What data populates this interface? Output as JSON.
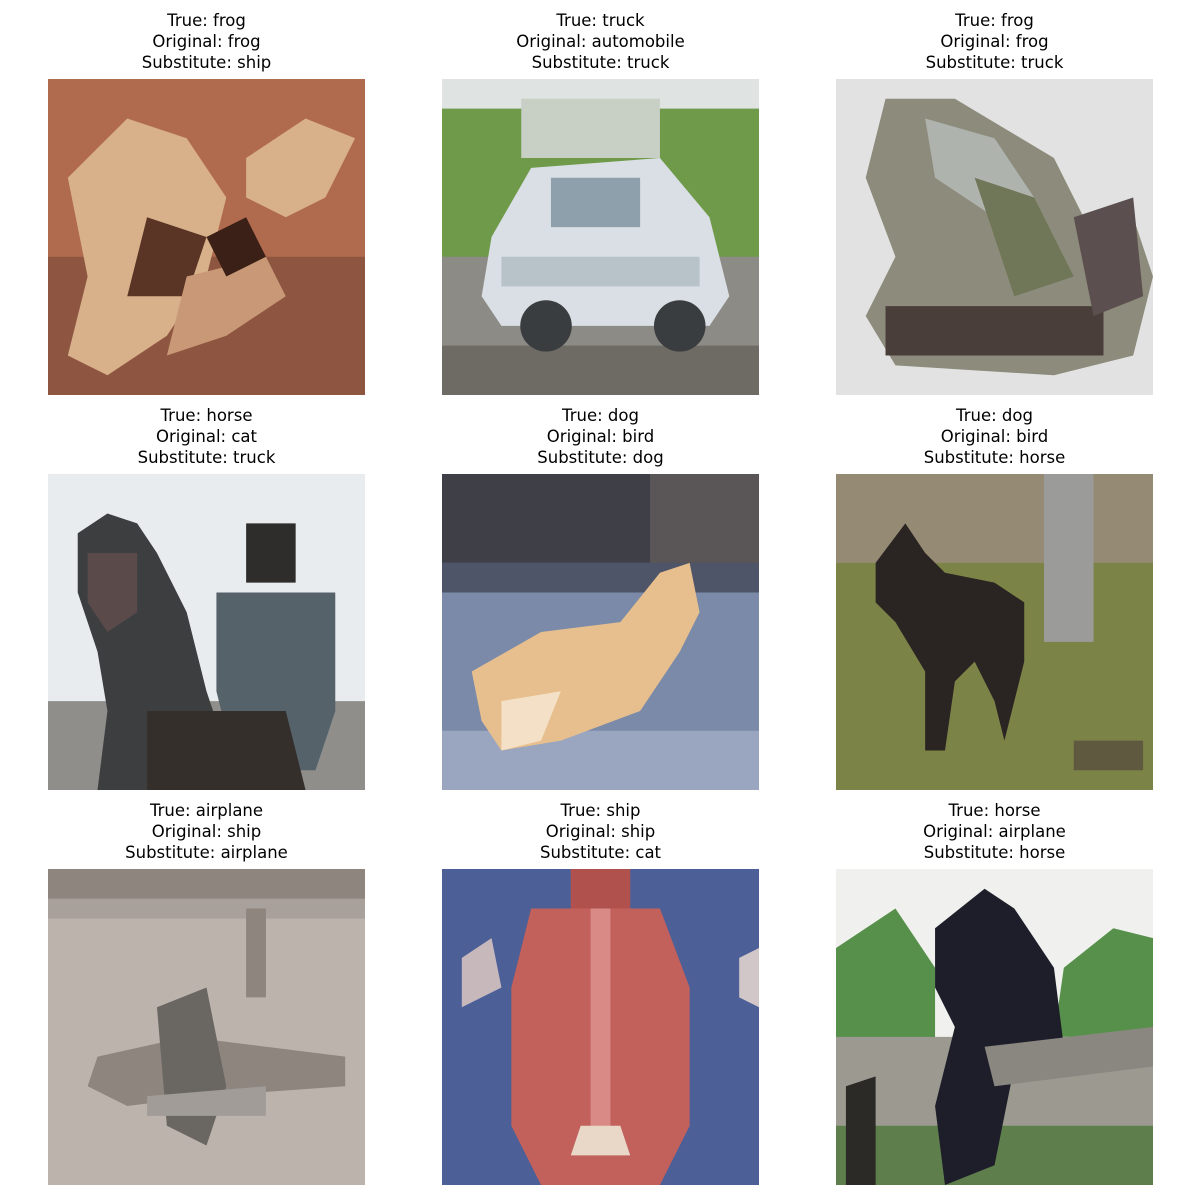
{
  "panels": [
    {
      "true_label": "True: frog",
      "original_label": "Original: frog",
      "substitute_label": "Substitute: ship",
      "image_subject": "frog",
      "palette": [
        "#b06a4e",
        "#d8b08a",
        "#5a3424"
      ]
    },
    {
      "true_label": "True: truck",
      "original_label": "Original: automobile",
      "substitute_label": "Substitute: truck",
      "image_subject": "truck",
      "palette": [
        "#6f9a4a",
        "#d9dfe4",
        "#3a3d40"
      ]
    },
    {
      "true_label": "True: frog",
      "original_label": "Original: frog",
      "substitute_label": "Substitute: truck",
      "image_subject": "frog",
      "palette": [
        "#e2e2e2",
        "#8d8b7c",
        "#4a3e3a"
      ]
    },
    {
      "true_label": "True: horse",
      "original_label": "Original: cat",
      "substitute_label": "Substitute: truck",
      "image_subject": "horse with rider",
      "palette": [
        "#e9ecef",
        "#56626a",
        "#2f2c2c"
      ]
    },
    {
      "true_label": "True: dog",
      "original_label": "Original: bird",
      "substitute_label": "Substitute: dog",
      "image_subject": "dog lying on floor",
      "palette": [
        "#7a8aa8",
        "#e7bf8e",
        "#3f3f47"
      ]
    },
    {
      "true_label": "True: dog",
      "original_label": "Original: bird",
      "substitute_label": "Substitute: horse",
      "image_subject": "dog on grass",
      "palette": [
        "#7c8347",
        "#2a2422",
        "#9b9b9a"
      ]
    },
    {
      "true_label": "True: airplane",
      "original_label": "Original: ship",
      "substitute_label": "Substitute: airplane",
      "image_subject": "airplane",
      "palette": [
        "#bdb3ad",
        "#8e857f",
        "#6a6762"
      ]
    },
    {
      "true_label": "True: ship",
      "original_label": "Original: ship",
      "substitute_label": "Substitute: cat",
      "image_subject": "ship",
      "palette": [
        "#4c5f97",
        "#c2605c",
        "#e9d8c8"
      ]
    },
    {
      "true_label": "True: horse",
      "original_label": "Original: airplane",
      "substitute_label": "Substitute: horse",
      "image_subject": "horse",
      "palette": [
        "#f0f0ee",
        "#56904a",
        "#1e1e2a"
      ]
    }
  ]
}
